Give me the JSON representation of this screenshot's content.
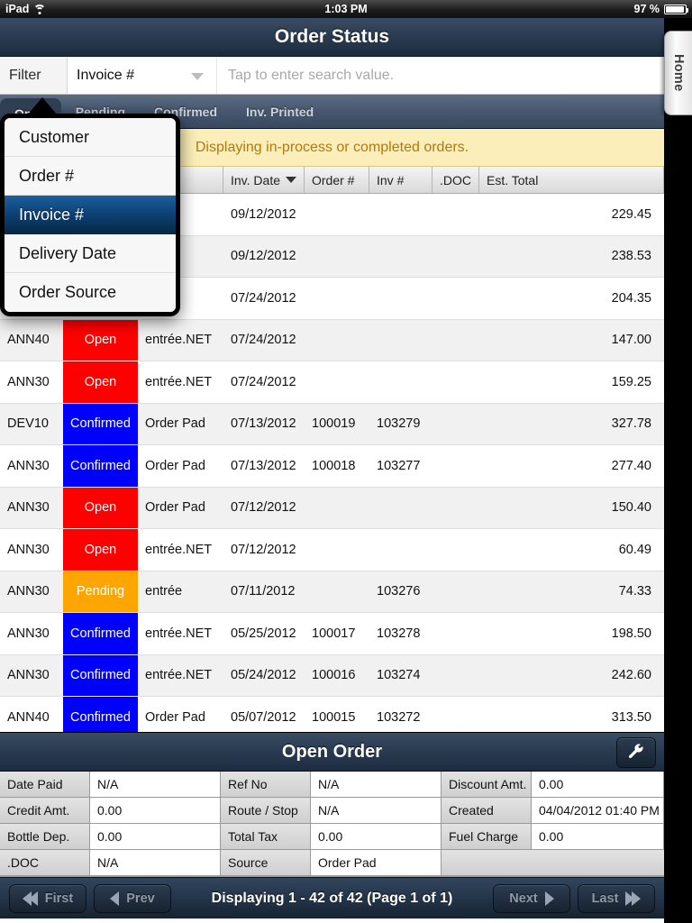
{
  "status_bar": {
    "device": "iPad",
    "wifi_icon": "wifi-icon",
    "time": "1:03 PM",
    "battery_percent": "97 %",
    "battery_icon": "battery-icon"
  },
  "header": {
    "title": "Order Status"
  },
  "side_tab": {
    "label": "Home"
  },
  "filter": {
    "label": "Filter",
    "selected": "Invoice #",
    "dropdown_icon": "chevron-down-icon",
    "search_placeholder": "Tap to enter search value.",
    "search_value": ""
  },
  "filter_options": [
    {
      "label": "Customer",
      "selected": false
    },
    {
      "label": "Order #",
      "selected": false
    },
    {
      "label": "Invoice #",
      "selected": true
    },
    {
      "label": "Delivery Date",
      "selected": false
    },
    {
      "label": "Order Source",
      "selected": false
    }
  ],
  "tabs": [
    {
      "label": "Open",
      "selected": true
    },
    {
      "label": "Pending",
      "selected": false
    },
    {
      "label": "Confirmed",
      "selected": false
    },
    {
      "label": "Inv. Printed",
      "selected": false
    }
  ],
  "notice": {
    "text": "Displaying in-process or completed orders."
  },
  "grid": {
    "columns": [
      {
        "label": "",
        "key": "customer"
      },
      {
        "label": "",
        "key": "status"
      },
      {
        "label": "e",
        "key": "source"
      },
      {
        "label": "Inv. Date",
        "key": "inv_date",
        "sorted": true,
        "sort_icon": "sort-descending-icon"
      },
      {
        "label": "Order #",
        "key": "order_no"
      },
      {
        "label": "Inv #",
        "key": "inv_no"
      },
      {
        "label": ".DOC",
        "key": "doc"
      },
      {
        "label": "Est. Total",
        "key": "est_total"
      }
    ],
    "status_colors": {
      "Open": "#FF0000",
      "Pending": "#FFA500",
      "Confirmed": "#0000FF"
    },
    "rows": [
      {
        "customer": "",
        "status": "",
        "source": "Pad",
        "inv_date": "09/12/2012",
        "order_no": "",
        "inv_no": "",
        "doc": "",
        "est_total": "229.45"
      },
      {
        "customer": "",
        "status": "",
        "source": ".NET",
        "inv_date": "09/12/2012",
        "order_no": "",
        "inv_no": "",
        "doc": "",
        "est_total": "238.53"
      },
      {
        "customer": "",
        "status": "",
        "source": ".NET",
        "inv_date": "07/24/2012",
        "order_no": "",
        "inv_no": "",
        "doc": "",
        "est_total": "204.35"
      },
      {
        "customer": "ANN40",
        "status": "Open",
        "source": "entrée.NET",
        "inv_date": "07/24/2012",
        "order_no": "",
        "inv_no": "",
        "doc": "",
        "est_total": "147.00"
      },
      {
        "customer": "ANN30",
        "status": "Open",
        "source": "entrée.NET",
        "inv_date": "07/24/2012",
        "order_no": "",
        "inv_no": "",
        "doc": "",
        "est_total": "159.25"
      },
      {
        "customer": "DEV10",
        "status": "Confirmed",
        "source": "Order Pad",
        "inv_date": "07/13/2012",
        "order_no": "100019",
        "inv_no": "103279",
        "doc": "",
        "est_total": "327.78"
      },
      {
        "customer": "ANN30",
        "status": "Confirmed",
        "source": "Order Pad",
        "inv_date": "07/13/2012",
        "order_no": "100018",
        "inv_no": "103277",
        "doc": "",
        "est_total": "277.40"
      },
      {
        "customer": "ANN30",
        "status": "Open",
        "source": "Order Pad",
        "inv_date": "07/12/2012",
        "order_no": "",
        "inv_no": "",
        "doc": "",
        "est_total": "150.40"
      },
      {
        "customer": "ANN30",
        "status": "Open",
        "source": "entrée.NET",
        "inv_date": "07/12/2012",
        "order_no": "",
        "inv_no": "",
        "doc": "",
        "est_total": "60.49"
      },
      {
        "customer": "ANN30",
        "status": "Pending",
        "source": "entrée",
        "inv_date": "07/11/2012",
        "order_no": "",
        "inv_no": "103276",
        "doc": "",
        "est_total": "74.33"
      },
      {
        "customer": "ANN30",
        "status": "Confirmed",
        "source": "entrée.NET",
        "inv_date": "05/25/2012",
        "order_no": "100017",
        "inv_no": "103278",
        "doc": "",
        "est_total": "198.50"
      },
      {
        "customer": "ANN30",
        "status": "Confirmed",
        "source": "entrée.NET",
        "inv_date": "05/24/2012",
        "order_no": "100016",
        "inv_no": "103274",
        "doc": "",
        "est_total": "242.60"
      },
      {
        "customer": "ANN40",
        "status": "Confirmed",
        "source": "Order Pad",
        "inv_date": "05/07/2012",
        "order_no": "100015",
        "inv_no": "103272",
        "doc": "",
        "est_total": "313.50"
      }
    ]
  },
  "detail": {
    "title": "Open Order",
    "settings_icon": "wrench-icon",
    "fields": [
      [
        {
          "label": "Date Paid",
          "value": "N/A"
        },
        {
          "label": "Ref No",
          "value": "N/A"
        },
        {
          "label": "Discount Amt.",
          "value": "0.00"
        }
      ],
      [
        {
          "label": "Credit Amt.",
          "value": "0.00"
        },
        {
          "label": "Route / Stop",
          "value": "N/A"
        },
        {
          "label": "Created",
          "value": "04/04/2012 01:40 PM"
        }
      ],
      [
        {
          "label": "Bottle Dep.",
          "value": "0.00"
        },
        {
          "label": "Total Tax",
          "value": "0.00"
        },
        {
          "label": "Fuel Charge",
          "value": "0.00"
        }
      ],
      [
        {
          "label": ".DOC",
          "value": "N/A"
        },
        {
          "label": "Source",
          "value": "Order Pad"
        },
        {
          "label": "",
          "value": ""
        }
      ]
    ]
  },
  "pager": {
    "first_label": "First",
    "prev_label": "Prev",
    "next_label": "Next",
    "last_label": "Last",
    "info": "Displaying 1 - 42 of 42 (Page 1 of 1)"
  }
}
